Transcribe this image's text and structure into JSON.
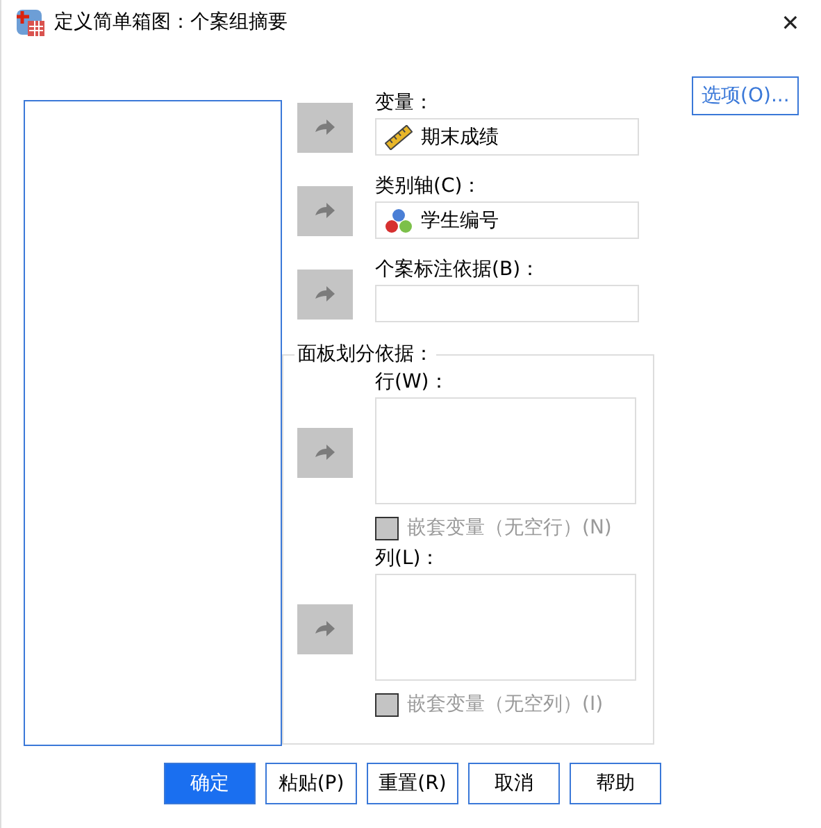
{
  "window": {
    "title": "定义简单箱图：个案组摘要",
    "close": "✕"
  },
  "targets": [
    {
      "label": "变量：",
      "value": "期末成绩",
      "kind": "scale",
      "arrow_disabled": true
    },
    {
      "label": "类别轴(C)：",
      "value": "学生编号",
      "kind": "nominal",
      "arrow_disabled": true
    },
    {
      "label": "个案标注依据(B)：",
      "arrow_disabled": true
    }
  ],
  "options_button": "选项(O)...",
  "panel": {
    "title": "面板划分依据：",
    "groups": [
      {
        "label": "行(W)：",
        "arrow_disabled": true,
        "nest": {
          "label": "嵌套变量（无空行）(N)",
          "checked": false,
          "disabled": true
        }
      },
      {
        "label": "列(L)：",
        "arrow_disabled": true,
        "nest": {
          "label": "嵌套变量（无空列）(I)",
          "checked": false,
          "disabled": true
        }
      }
    ]
  },
  "buttons": [
    {
      "label": "确定",
      "default": true
    },
    {
      "label": "粘贴(P)",
      "default": false
    },
    {
      "label": "重置(R)",
      "default": false
    },
    {
      "label": "取消",
      "default": false
    },
    {
      "label": "帮助",
      "default": false
    }
  ]
}
